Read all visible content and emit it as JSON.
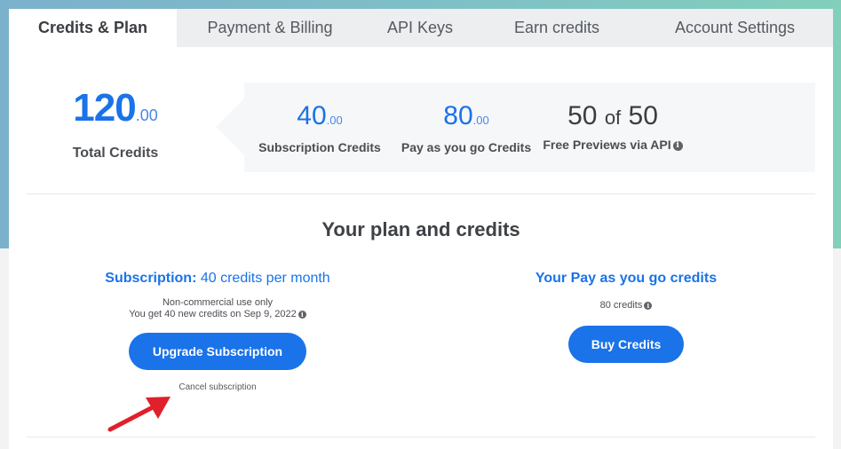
{
  "tabs": [
    {
      "label": "Credits & Plan",
      "active": true
    },
    {
      "label": "Payment & Billing",
      "active": false
    },
    {
      "label": "API Keys",
      "active": false
    },
    {
      "label": "Earn credits",
      "active": false
    },
    {
      "label": "Account Settings",
      "active": false
    }
  ],
  "summary": {
    "total": {
      "value": "120",
      "decimals": ".00",
      "label": "Total Credits"
    },
    "stats": [
      {
        "value": "40",
        "decimals": ".00",
        "label": "Subscription Credits"
      },
      {
        "value": "80",
        "decimals": ".00",
        "label": "Pay as you go Credits"
      },
      {
        "value": "50",
        "of_label": "of",
        "total": "50",
        "label": "Free Previews via API",
        "icon": "info-icon"
      }
    ]
  },
  "plan": {
    "title": "Your plan and credits",
    "subscription": {
      "heading_bold": "Subscription:",
      "heading_rest": " 40 credits per month",
      "line1": "Non-commercial use only",
      "line2": "You get 40 new credits on Sep 9, 2022",
      "button_label": "Upgrade Subscription",
      "cancel_label": "Cancel subscription"
    },
    "payg": {
      "heading": "Your Pay as you go credits",
      "amount": "80 credits",
      "button_label": "Buy Credits"
    }
  },
  "annotation": {
    "type": "red-arrow",
    "points_to": "Cancel subscription",
    "color": "#e0202a"
  },
  "colors": {
    "accent": "#1a73e8",
    "tab_inactive_bg": "#eceef0",
    "panel_bg": "#f6f7f9"
  }
}
